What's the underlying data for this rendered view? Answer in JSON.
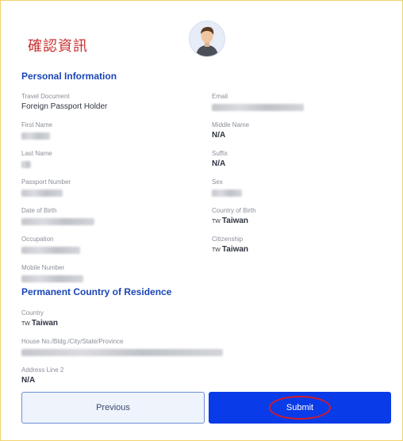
{
  "page": {
    "heading": "確認資訊"
  },
  "personal": {
    "title": "Personal Information",
    "travel_document_label": "Travel Document",
    "travel_document_value": "Foreign Passport Holder",
    "email_label": "Email",
    "first_name_label": "First Name",
    "middle_name_label": "Middle Name",
    "middle_name_value": "N/A",
    "last_name_label": "Last Name",
    "suffix_label": "Suffix",
    "suffix_value": "N/A",
    "passport_number_label": "Passport Number",
    "sex_label": "Sex",
    "date_of_birth_label": "Date of Birth",
    "country_of_birth_label": "Country of Birth",
    "country_of_birth_code": "TW",
    "country_of_birth_value": "Taiwan",
    "occupation_label": "Occupation",
    "citizenship_label": "Citizenship",
    "citizenship_code": "TW",
    "citizenship_value": "Taiwan",
    "mobile_number_label": "Mobile Number"
  },
  "residence": {
    "title": "Permanent Country of Residence",
    "country_label": "Country",
    "country_code": "TW",
    "country_value": "Taiwan",
    "house_label": "House No./Bldg./City/State/Province",
    "address2_label": "Address Line 2",
    "address2_value": "N/A"
  },
  "buttons": {
    "previous": "Previous",
    "submit": "Submit"
  },
  "colors": {
    "heading": "#c8302f",
    "section_title": "#1a46b8",
    "submit_bg": "#0a3be8",
    "previous_bg": "#eef3fc",
    "annotation_ring": "#d11a2a",
    "frame_border": "#f1d36e"
  },
  "icons": {
    "avatar": "user-avatar-icon"
  }
}
